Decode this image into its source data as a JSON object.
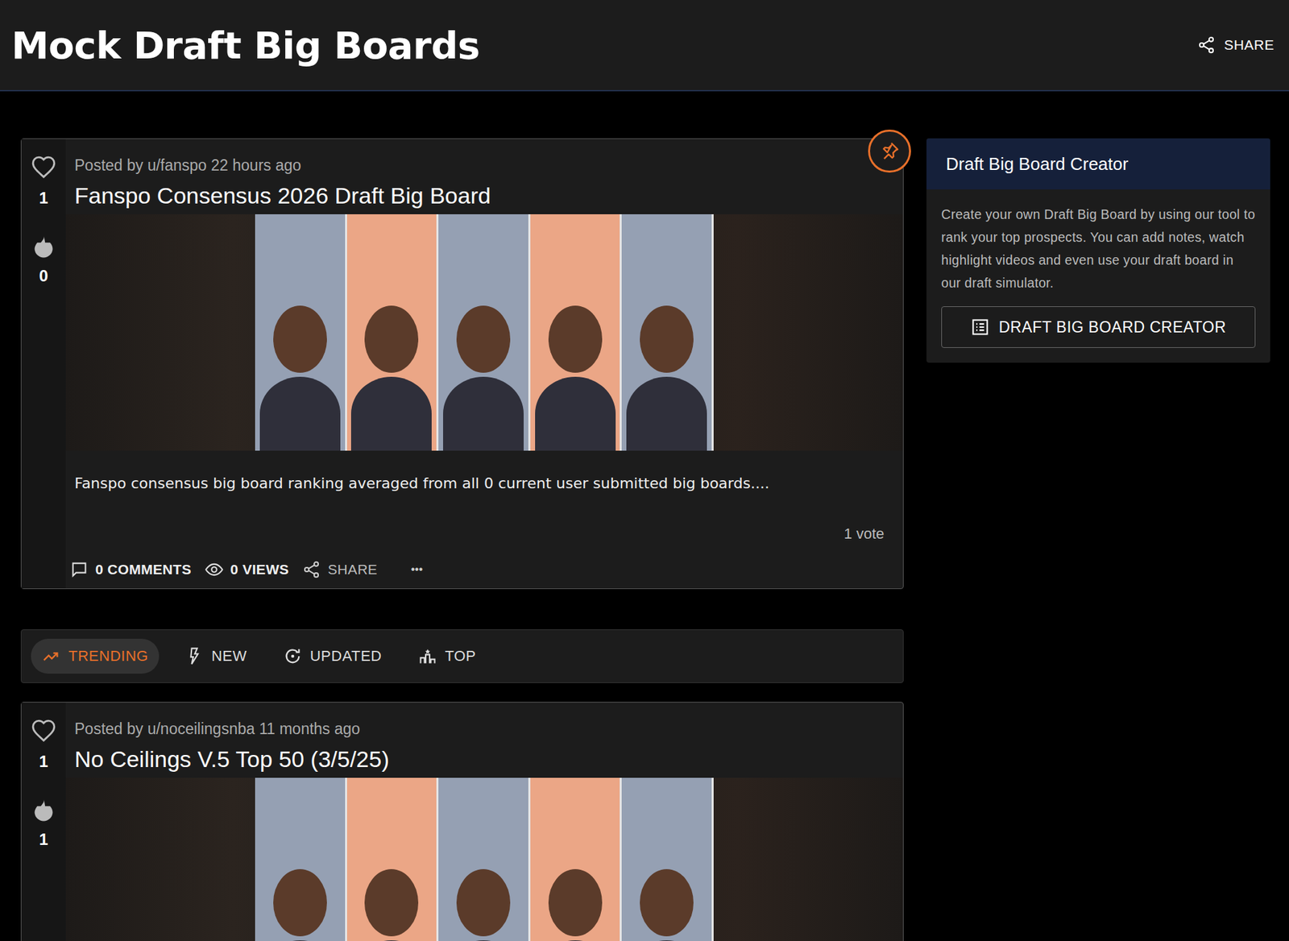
{
  "header": {
    "title": "Mock Draft Big Boards",
    "share": "SHARE"
  },
  "posts": [
    {
      "author": "Posted by u/fanspo 22 hours ago",
      "title": "Fanspo Consensus 2026 Draft Big Board",
      "likes": "1",
      "fire": "0",
      "pinned": true,
      "description": "Fanspo consensus big board ranking averaged from all 0 current user submitted big boards....",
      "votes": "1 vote",
      "comments": "0 COMMENTS",
      "views": "0 VIEWS",
      "share": "SHARE",
      "more": "•••"
    },
    {
      "author": "Posted by u/noceilingsnba 11 months ago",
      "title": "No Ceilings V.5 Top 50 (3/5/25)",
      "likes": "1",
      "fire": "1",
      "pinned": false
    }
  ],
  "tabs": [
    {
      "label": "TRENDING",
      "selected": true
    },
    {
      "label": "NEW",
      "selected": false
    },
    {
      "label": "UPDATED",
      "selected": false
    },
    {
      "label": "TOP",
      "selected": false
    }
  ],
  "sidebar": {
    "title": "Draft Big Board Creator",
    "text": "Create your own Draft Big Board by using our tool to rank your top prospects. You can add notes, watch highlight videos and even use your draft board in our draft simulator.",
    "button": "DRAFT BIG BOARD CREATOR"
  }
}
